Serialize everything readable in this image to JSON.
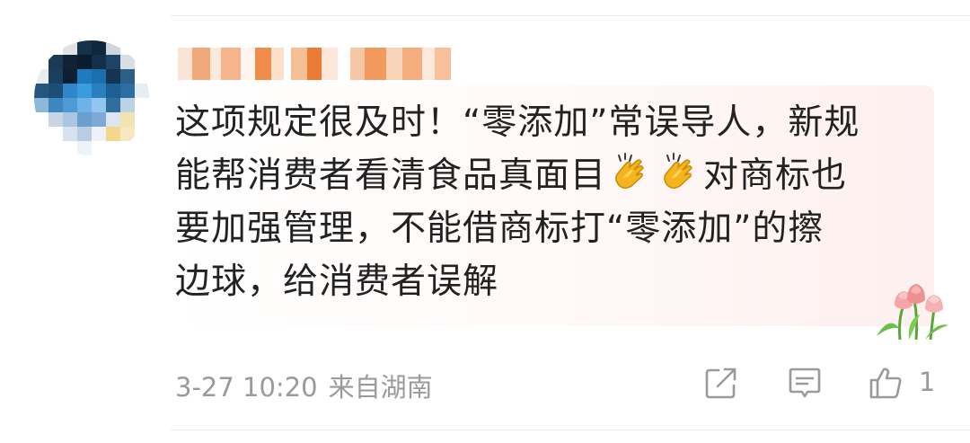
{
  "comment": {
    "lines": [
      "这项规定很及时！“零添加”常误导人，新规",
      "能帮消费者看清食品真面目",
      "对商标也",
      "要加强管理，不能借商标打“零添加”的擦",
      "边球，给消费者误解"
    ],
    "emoji": "clapping-hands",
    "sticker": "tulip-flowers"
  },
  "meta": {
    "date_time": "3-27 10:20",
    "source": "来自湖南"
  },
  "actions": {
    "share_icon": "share-icon",
    "reply_icon": "comment-icon",
    "like_icon": "thumbs-up-icon",
    "like_count": "1"
  },
  "colors": {
    "text": "#222222",
    "meta": "#9a9a9a",
    "bubble_tint": "#fdf0ef",
    "icon": "#9a9a9a"
  }
}
